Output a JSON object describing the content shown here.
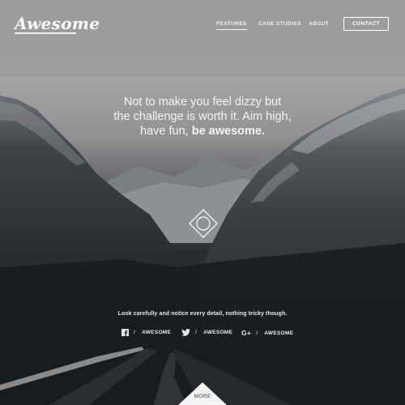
{
  "brand": {
    "logo_text": "Awesome"
  },
  "nav": {
    "links": [
      {
        "label": "FEATURES",
        "active": true
      },
      {
        "label": "CASE STUDIES",
        "active": false
      },
      {
        "label": "ABOUT",
        "active": false
      }
    ],
    "contact_label": "CONTACT"
  },
  "hero": {
    "tagline_line1": "Not to make you feel dizzy but",
    "tagline_line2": "the challenge is worth it. Aim high,",
    "tagline_line3_prefix": "have fun,",
    "tagline_line3_strong": "be awesome."
  },
  "footer": {
    "notice": "Look carefully and notice every detail, nothing tricky though.",
    "social": [
      {
        "icon": "facebook-icon",
        "separator": "/",
        "label": "AWESOME"
      },
      {
        "icon": "twitter-icon",
        "separator": "/",
        "label": "AWESOME"
      },
      {
        "icon": "google-plus-icon",
        "separator": "/",
        "label": "AWESOME"
      }
    ],
    "more_label": "MORE"
  },
  "colors": {
    "sky": "#9c9d9f",
    "mountain": "#2b2e32",
    "snow": "#b9bcc0",
    "text": "#ffffff"
  }
}
